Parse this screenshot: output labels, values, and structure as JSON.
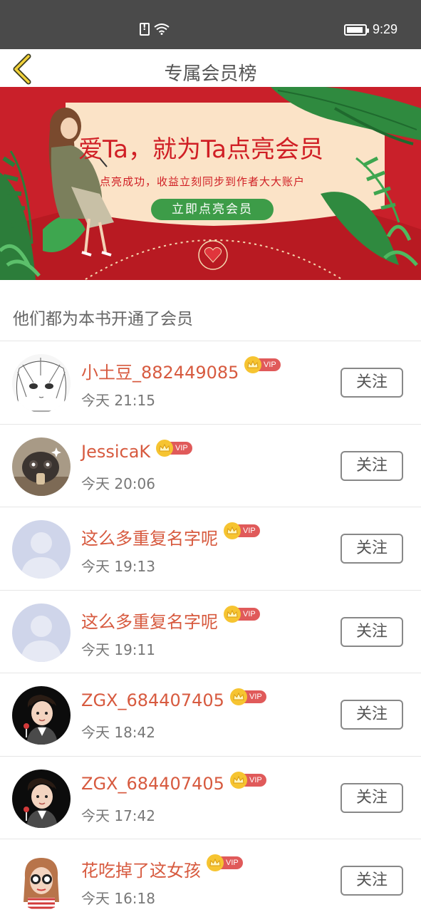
{
  "status_bar": {
    "time": "9:29",
    "icons": [
      "sim-alert-icon",
      "wifi-icon",
      "battery-icon"
    ]
  },
  "header": {
    "title": "专属会员榜",
    "back_icon": "chevron-left-icon"
  },
  "banner": {
    "headline": "爱Ta，就为Ta点亮会员",
    "subline": "点亮成功，收益立刻同步到作者大大账户",
    "cta_label": "立即点亮会员",
    "colors": {
      "background": "#c9202a",
      "card": "#fbe3c7",
      "cta": "#3d9c48",
      "text": "#d01f25"
    }
  },
  "section": {
    "title": "他们都为本书开通了会员"
  },
  "vip_label": "VIP",
  "follow_label": "关注",
  "members": [
    {
      "name": "小土豆_882449085",
      "time": "今天 21:15",
      "avatar": "sketch-avatar"
    },
    {
      "name": "JessicaK",
      "time": "今天 20:06",
      "avatar": "pet-photo-avatar"
    },
    {
      "name": "这么多重复名字呢",
      "time": "今天 19:13",
      "avatar": "default-avatar"
    },
    {
      "name": "这么多重复名字呢",
      "time": "今天 19:11",
      "avatar": "default-avatar"
    },
    {
      "name": "ZGX_684407405",
      "time": "今天 18:42",
      "avatar": "cartoon-man-avatar"
    },
    {
      "name": "ZGX_684407405",
      "time": "今天 17:42",
      "avatar": "cartoon-man-avatar"
    },
    {
      "name": "花吃掉了这女孩",
      "time": "今天 16:18",
      "avatar": "cartoon-girl-avatar"
    }
  ],
  "colors": {
    "accent_name": "#d75a3f",
    "vip_badge": "#e05a5a",
    "crown": "#f6c431",
    "status_bar": "#4a4a4a"
  }
}
